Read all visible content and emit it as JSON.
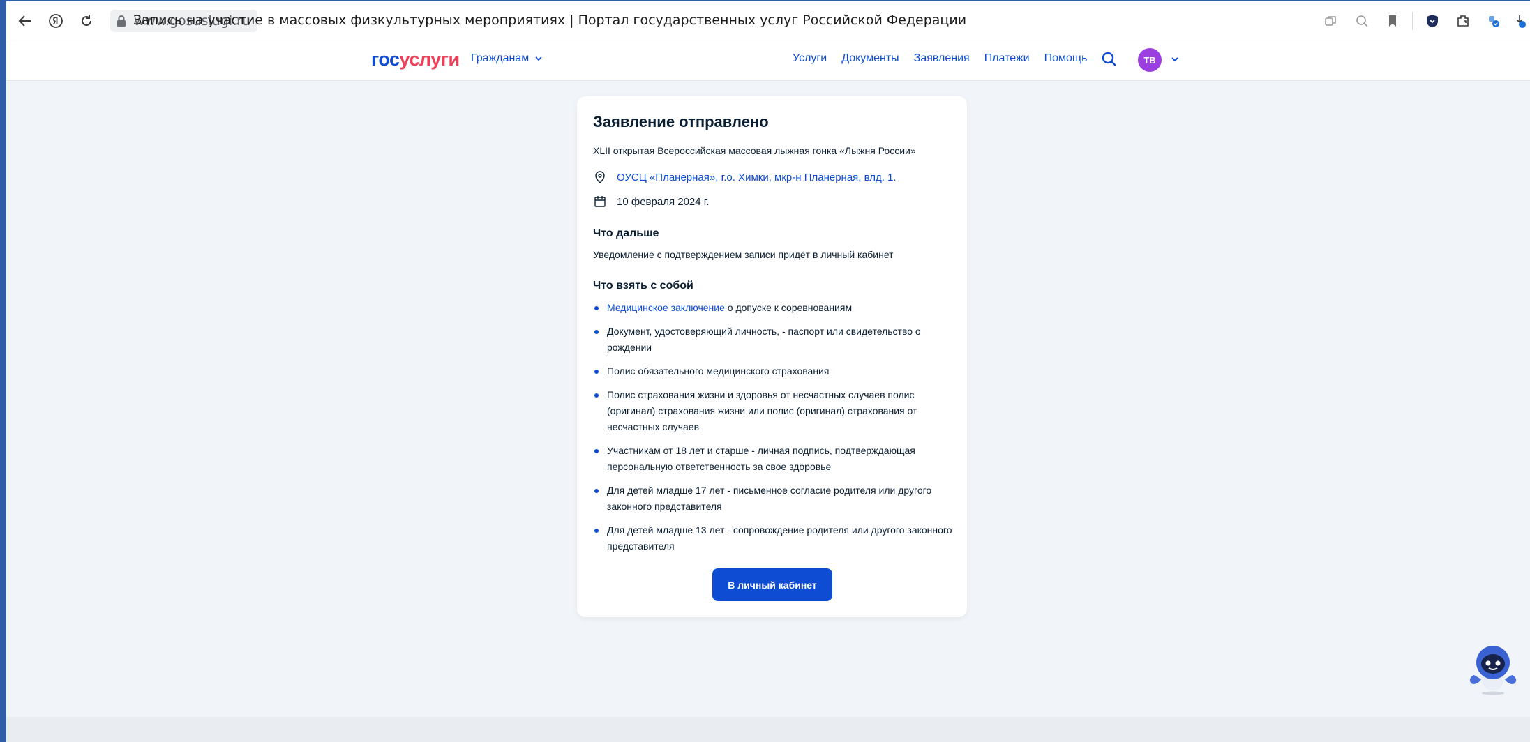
{
  "browser": {
    "url": "www.gosuslugi.ru",
    "tab_title": "Запись на участие в массовых физкультурных мероприятиях | Портал государственных услуг Российской Федерации"
  },
  "header": {
    "logo_part1": "гос",
    "logo_part2": "услуги",
    "citizens_label": "Гражданам",
    "nav": [
      "Услуги",
      "Документы",
      "Заявления",
      "Платежи",
      "Помощь"
    ],
    "avatar_initials": "ТВ"
  },
  "card": {
    "title": "Заявление отправлено",
    "event_name": "XLII открытая Всероссийская массовая лыжная гонка «Лыжня России»",
    "location": "ОУСЦ «Планерная», г.о. Химки, мкр-н Планерная, влд. 1.",
    "date": "10 февраля 2024 г.",
    "next_heading": "Что дальше",
    "next_text": "Уведомление с подтверждением записи придёт в личный кабинет",
    "bring_heading": "Что взять с собой",
    "bring_items": [
      {
        "link": "Медицинское заключение",
        "text": " о допуске к соревнованиям"
      },
      {
        "text": "Документ, удостоверяющий личность, - паспорт или свидетельство о рождении"
      },
      {
        "text": "Полис обязательного медицинского страхования"
      },
      {
        "text": "Полис страхования жизни и здоровья от несчастных случаев полис (оригинал) страхования жизни или полис (оригинал) страхования от несчастных случаев"
      },
      {
        "text": "Участникам от 18 лет и старше - личная подпись, подтверждающая персональную ответственность за свое здоровье"
      },
      {
        "text": "Для детей младше 17 лет - письменное согласие родителя или другого законного представителя"
      },
      {
        "text": "Для детей младше 13 лет - сопровождение родителя или другого законного представителя"
      }
    ],
    "button_label": "В личный кабинет"
  },
  "colors": {
    "primary": "#0d4cd3",
    "logo_red": "#ee3f58",
    "avatar": "#9b3fe0",
    "page_bg": "#f1f4f8"
  }
}
